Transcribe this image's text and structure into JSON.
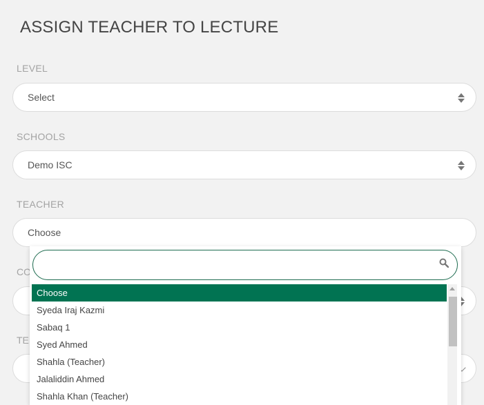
{
  "page": {
    "title": "ASSIGN TEACHER TO LECTURE"
  },
  "level": {
    "label": "LEVEL",
    "value": "Select",
    "icon": "updown-arrows-icon"
  },
  "schools": {
    "label": "SCHOOLS",
    "value": "Demo ISC",
    "icon": "updown-arrows-icon"
  },
  "teacher": {
    "label": "TEACHER",
    "value": "Choose",
    "dropdown": {
      "search_value": "",
      "search_icon": "search-icon",
      "options": [
        {
          "label": "Choose",
          "selected": true
        },
        {
          "label": "Syeda Iraj Kazmi"
        },
        {
          "label": "Sabaq 1"
        },
        {
          "label": "Syed Ahmed"
        },
        {
          "label": "Shahla (Teacher)"
        },
        {
          "label": "Jalaliddin Ahmed"
        },
        {
          "label": "Shahla Khan (Teacher)"
        }
      ]
    }
  },
  "hidden_fields": {
    "field4_label_fragment": "CO",
    "field5_label_fragment": "TE"
  },
  "colors": {
    "accent": "#017352",
    "focus_border": "#1d6b4f",
    "background": "#f2f2f2"
  }
}
